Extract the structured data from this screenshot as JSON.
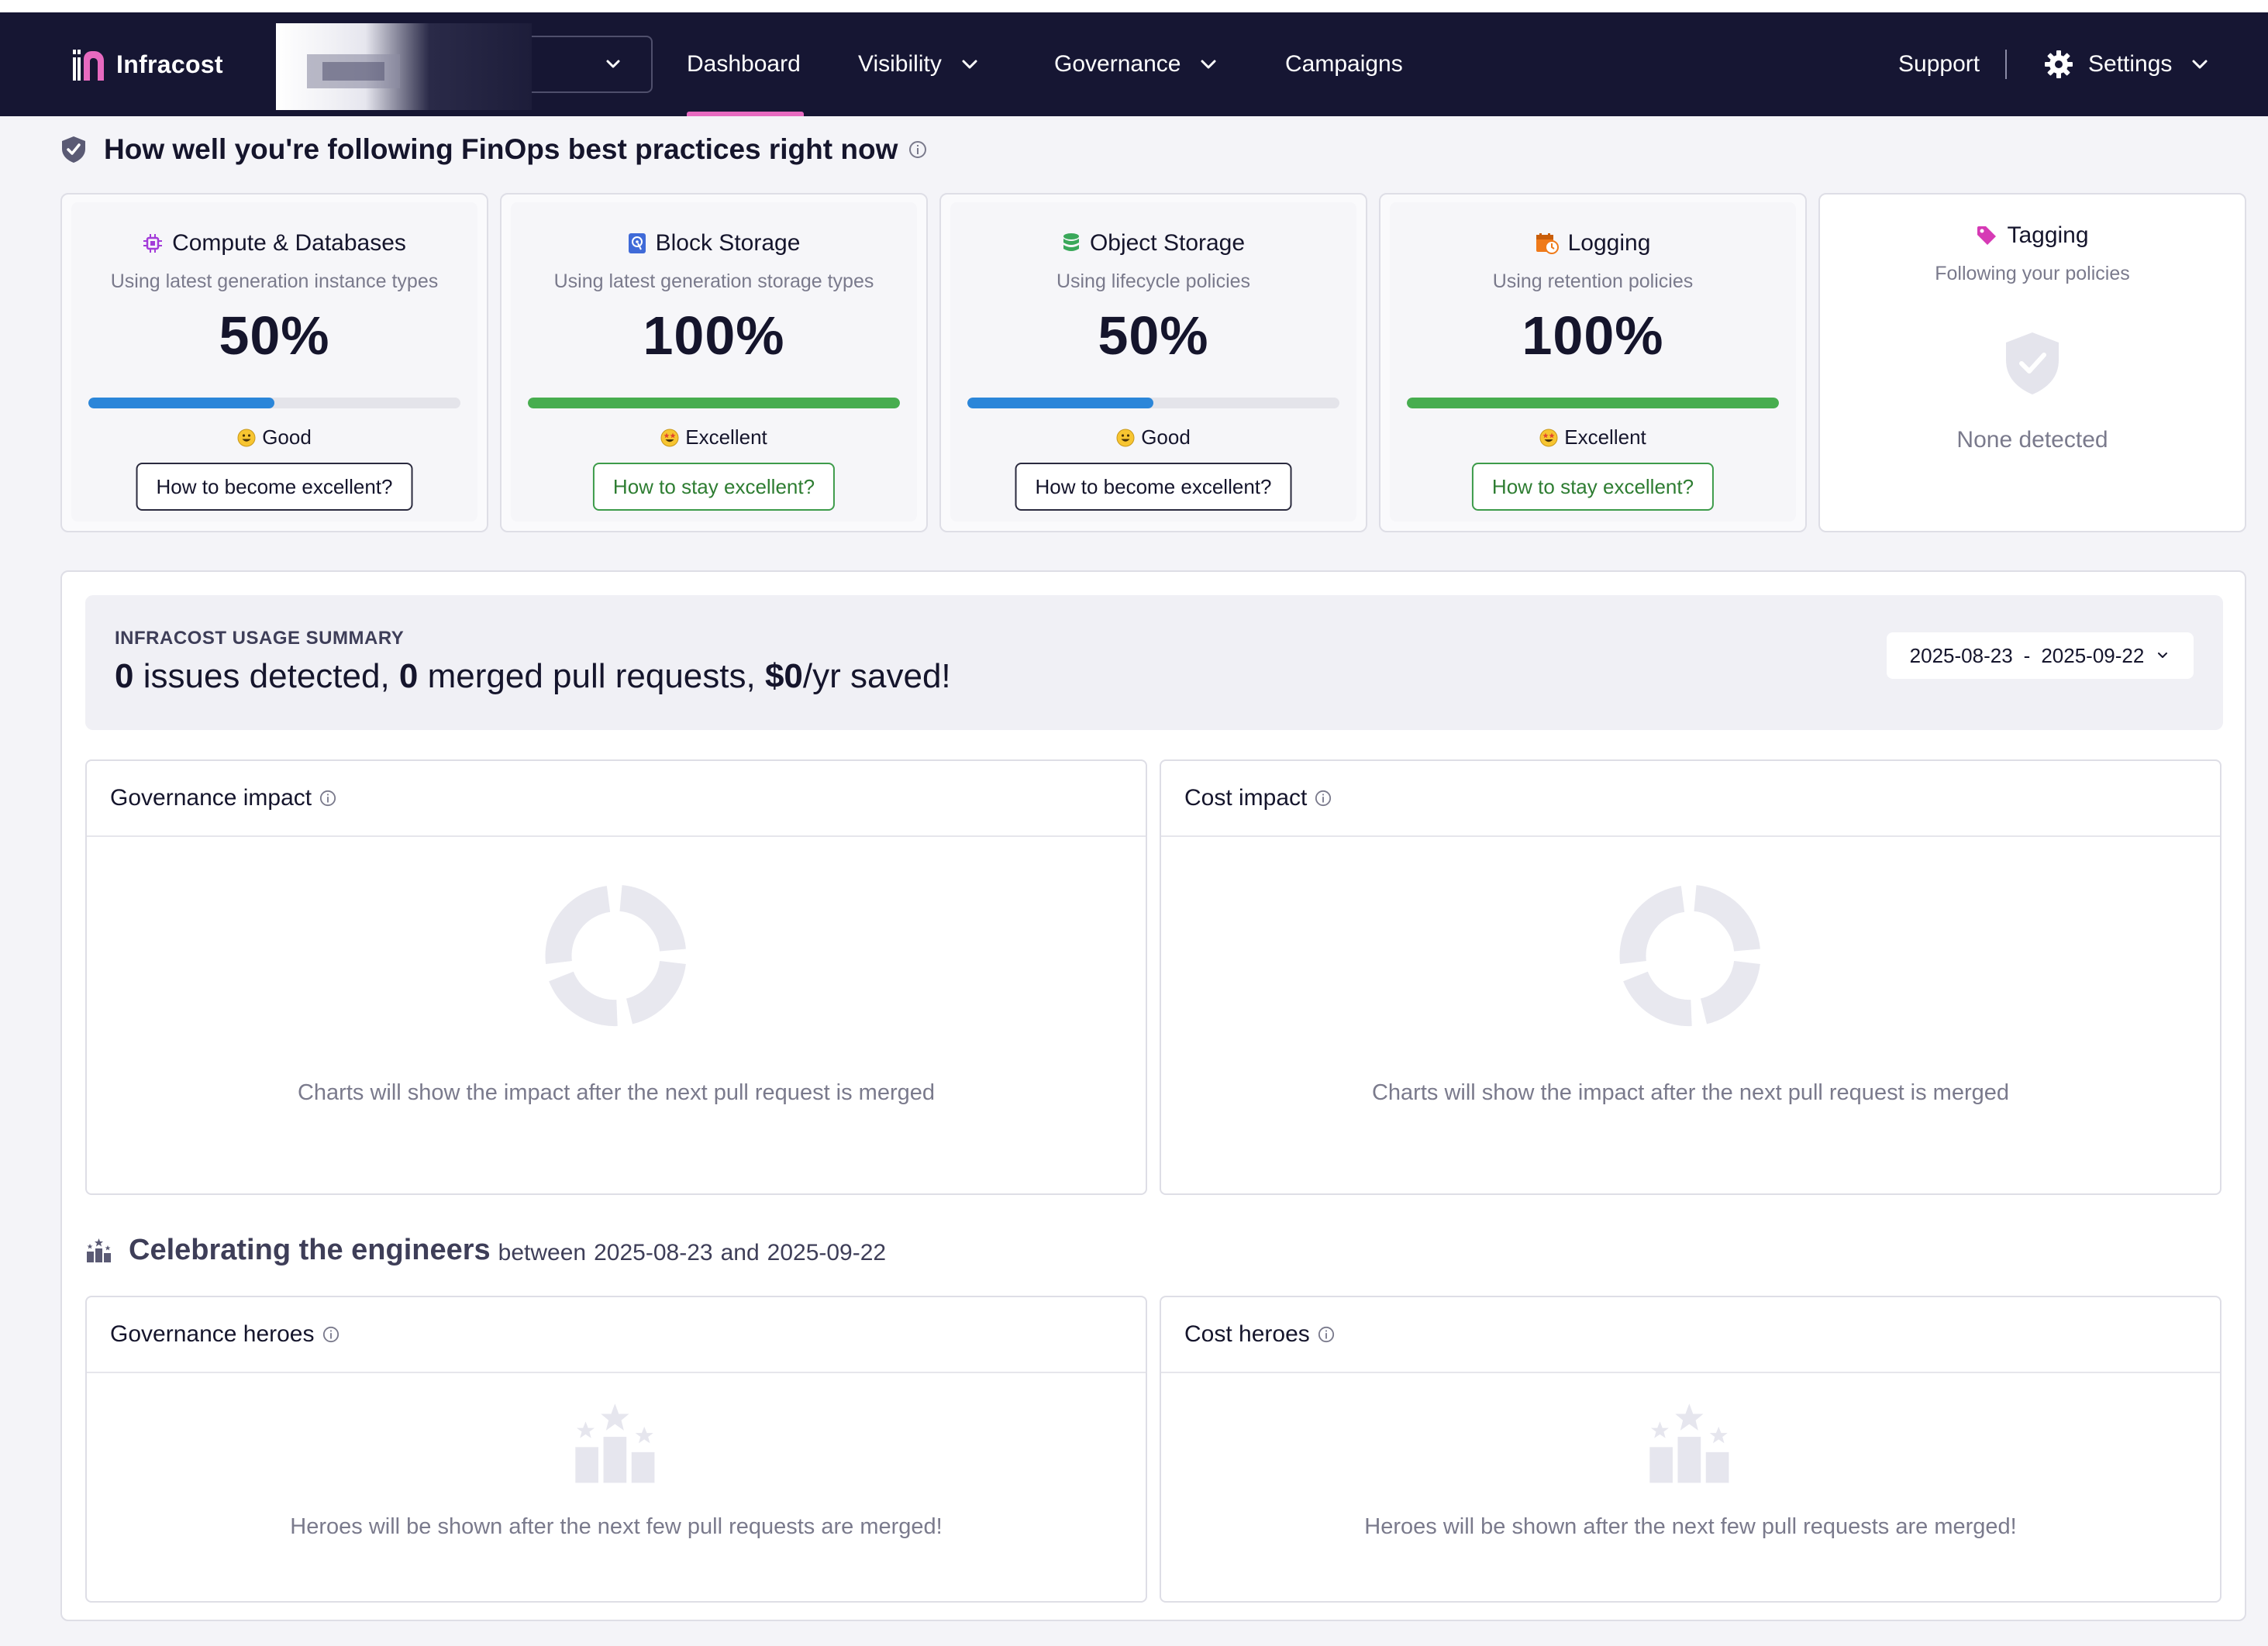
{
  "nav": {
    "logo_text": "Infracost",
    "org_select": "",
    "items": [
      {
        "label": "Dashboard",
        "active": true
      },
      {
        "label": "Visibility"
      },
      {
        "label": "Governance"
      },
      {
        "label": "Campaigns"
      }
    ],
    "support": "Support",
    "settings": "Settings"
  },
  "best_practices": {
    "title": "How well you're following FinOps best practices right now",
    "cards": [
      {
        "title": "Compute & Databases",
        "subtitle": "Using latest generation instance types",
        "percent": "50%",
        "progress": 0.5,
        "rating": "Good",
        "button": "How to become excellent?",
        "icon": "chip-icon"
      },
      {
        "title": "Block Storage",
        "subtitle": "Using latest generation storage types",
        "percent": "100%",
        "progress": 1.0,
        "rating": "Excellent",
        "button": "How to stay excellent?",
        "icon": "disk-icon"
      },
      {
        "title": "Object Storage",
        "subtitle": "Using lifecycle policies",
        "percent": "50%",
        "progress": 0.5,
        "rating": "Good",
        "button": "How to become excellent?",
        "icon": "database-icon"
      },
      {
        "title": "Logging",
        "subtitle": "Using retention policies",
        "percent": "100%",
        "progress": 1.0,
        "rating": "Excellent",
        "button": "How to stay excellent?",
        "icon": "calendar-clock-icon"
      },
      {
        "title": "Tagging",
        "subtitle": "Following your policies",
        "none": "None detected",
        "icon": "tag-icon"
      }
    ]
  },
  "usage": {
    "label": "INFRACOST USAGE SUMMARY",
    "issues_count": "0",
    "issues_text": " issues detected, ",
    "prs_count": "0",
    "prs_text": " merged pull requests, ",
    "saved_amount": "$0",
    "saved_text": "/yr saved!",
    "date_from": "2025-08-23",
    "date_sep": "-",
    "date_to": "2025-09-22"
  },
  "panels": {
    "governance_impact": {
      "title": "Governance impact",
      "message": "Charts will show the impact after the next pull request is merged"
    },
    "cost_impact": {
      "title": "Cost impact",
      "message": "Charts will show the impact after the next pull request is merged"
    },
    "governance_heroes": {
      "title": "Governance heroes",
      "message": "Heroes will be shown after the next few pull requests are merged!"
    },
    "cost_heroes": {
      "title": "Cost heroes",
      "message": "Heroes will be shown after the next few pull requests are merged!"
    }
  },
  "celebrate": {
    "title": "Celebrating the engineers",
    "between": "between",
    "date_from": "2025-08-23",
    "and": "and",
    "date_to": "2025-09-22"
  },
  "colors": {
    "navbar": "#161633",
    "accent_pink": "#e76ac0",
    "progress_blue": "#2b86d9",
    "progress_green": "#47ad4f",
    "button_green": "#3d9b4a"
  }
}
